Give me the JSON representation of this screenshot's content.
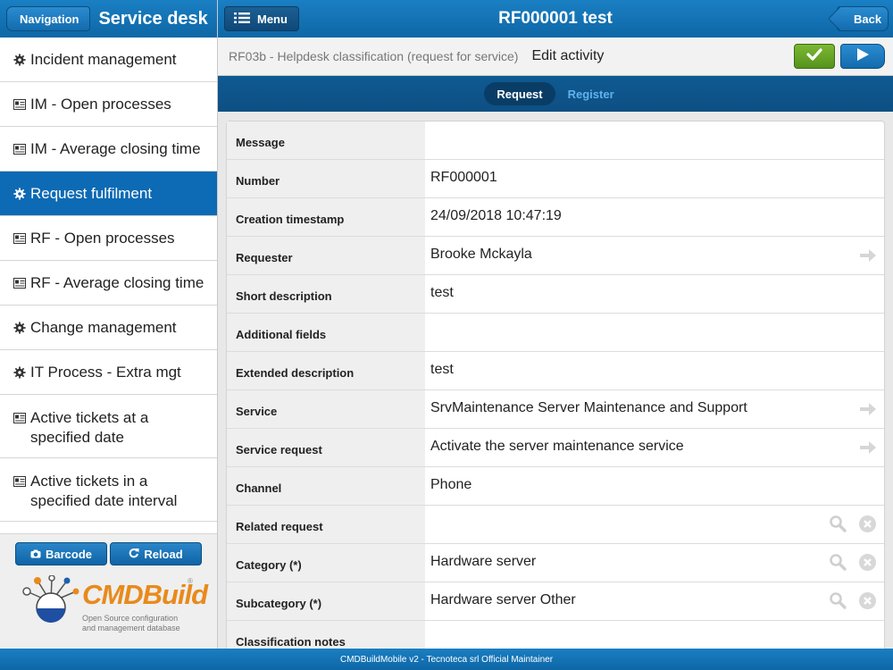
{
  "sidebar": {
    "nav_label": "Navigation",
    "title": "Service desk",
    "items": [
      {
        "label": "Incident management",
        "icon": "gear-icon"
      },
      {
        "label": "IM - Open processes",
        "icon": "report-icon"
      },
      {
        "label": "IM - Average closing time",
        "icon": "report-icon"
      },
      {
        "label": "Request fulfilment",
        "icon": "gear-icon",
        "active": true
      },
      {
        "label": "RF - Open processes",
        "icon": "report-icon"
      },
      {
        "label": "RF - Average closing time",
        "icon": "report-icon"
      },
      {
        "label": "Change management",
        "icon": "gear-icon"
      },
      {
        "label": "IT Process - Extra mgt",
        "icon": "gear-icon"
      },
      {
        "label": "Active tickets at a specified date",
        "icon": "report-icon"
      },
      {
        "label": "Active tickets in a specified date interval",
        "icon": "report-icon"
      }
    ],
    "barcode_label": "Barcode",
    "reload_label": "Reload",
    "logo": {
      "name": "CMDBuild",
      "tagline_1": "Open Source configuration",
      "tagline_2": "and management database"
    }
  },
  "header": {
    "menu_label": "Menu",
    "title": "RF000001 test",
    "back_label": "Back"
  },
  "subheader": {
    "code": "RF03b - Helpdesk classification (request for service)",
    "activity": "Edit activity"
  },
  "tabs": [
    {
      "label": "Request",
      "active": true
    },
    {
      "label": "Register",
      "active": false
    }
  ],
  "form": {
    "rows": [
      {
        "label": "Message",
        "value": ""
      },
      {
        "label": "Number",
        "value": "RF000001"
      },
      {
        "label": "Creation timestamp",
        "value": "24/09/2018 10:47:19"
      },
      {
        "label": "Requester",
        "value": "Brooke Mckayla",
        "action": "arrow"
      },
      {
        "label": "Short description",
        "value": "test"
      },
      {
        "label": "Additional fields",
        "value": ""
      },
      {
        "label": "Extended description",
        "value": "test"
      },
      {
        "label": "Service",
        "value": "SrvMaintenance Server Maintenance and Support",
        "action": "arrow"
      },
      {
        "label": "Service request",
        "value": "Activate the server maintenance service",
        "action": "arrow"
      },
      {
        "label": "Channel",
        "value": "Phone"
      },
      {
        "label": "Related request",
        "value": "",
        "action": "lookup"
      },
      {
        "label": "Category (*)",
        "value": "Hardware server",
        "action": "lookup"
      },
      {
        "label": "Subcategory (*)",
        "value": "Hardware server Other",
        "action": "lookup"
      },
      {
        "label": "Classification notes",
        "value": ""
      }
    ]
  },
  "footer": {
    "text": "CMDBuildMobile v2 - Tecnoteca srl Official Maintainer"
  },
  "colors": {
    "header_blue": "#1475bb",
    "active_item": "#0d6ab4",
    "confirm_green": "#6aa927",
    "logo_orange": "#e88a1c"
  }
}
